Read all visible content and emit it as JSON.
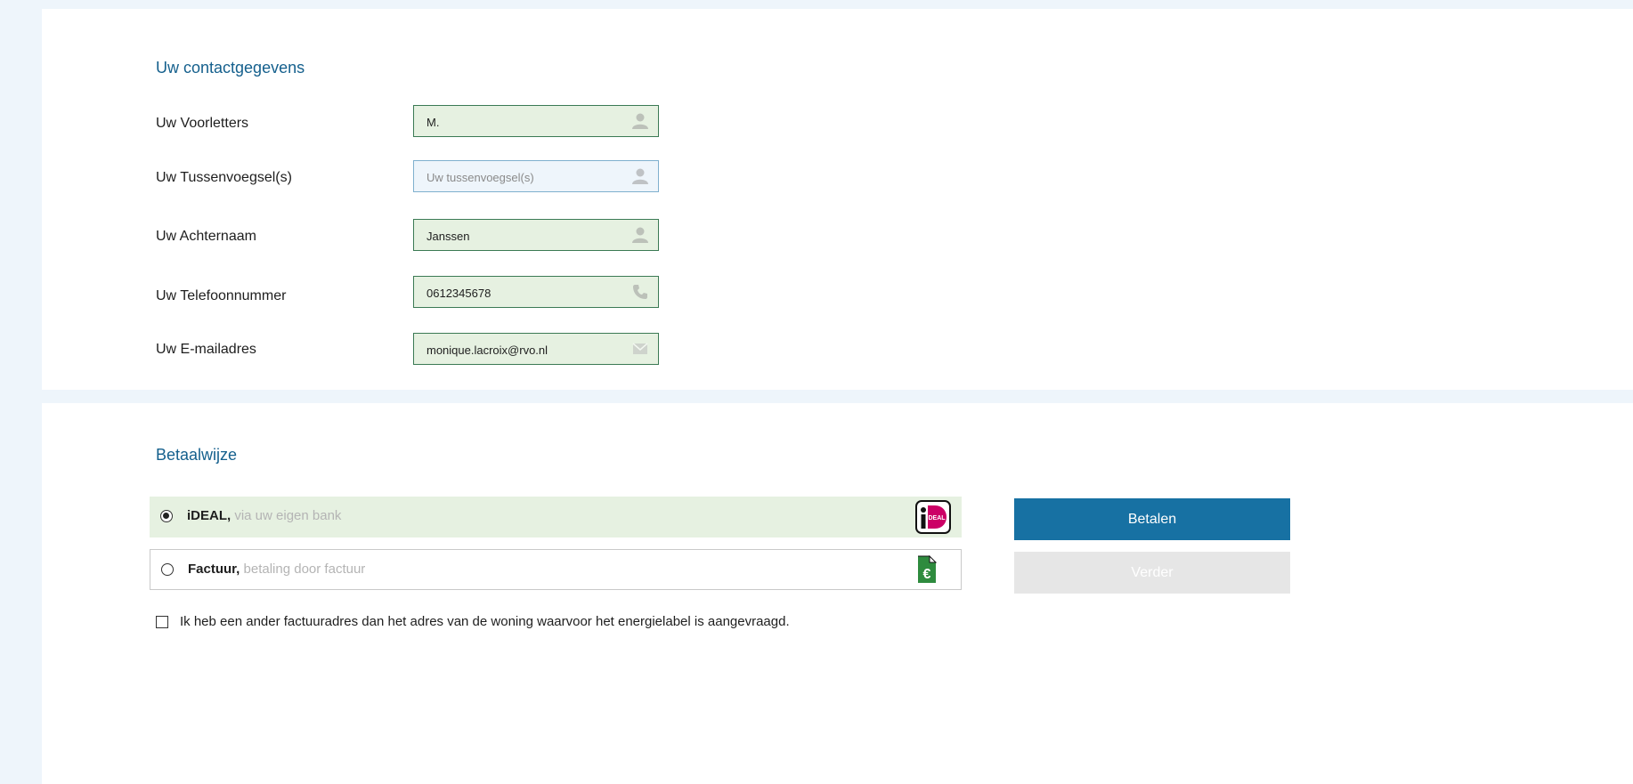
{
  "contact": {
    "title": "Uw contactgegevens",
    "fields": [
      {
        "label": "Uw Voorletters",
        "value": "M.",
        "placeholder": "",
        "icon": "person-icon"
      },
      {
        "label": "Uw Tussenvoegsel(s)",
        "value": "",
        "placeholder": "Uw tussenvoegsel(s)",
        "icon": "person-icon"
      },
      {
        "label": "Uw Achternaam",
        "value": "Janssen",
        "placeholder": "",
        "icon": "person-icon"
      },
      {
        "label": "Uw Telefoonnummer",
        "value": "0612345678",
        "placeholder": "",
        "icon": "phone-icon"
      },
      {
        "label": "Uw E-mailadres",
        "value": "monique.lacroix@rvo.nl",
        "placeholder": "",
        "icon": "envelope-icon"
      }
    ]
  },
  "payment": {
    "title": "Betaalwijze",
    "options": [
      {
        "name": "iDEAL,",
        "description": "via uw eigen bank",
        "selected": true,
        "icon": "ideal-logo-icon"
      },
      {
        "name": "Factuur,",
        "description": "betaling door factuur",
        "selected": false,
        "icon": "euro-invoice-icon"
      }
    ],
    "pay_button": "Betalen",
    "next_button": "Verder",
    "invoice_checkbox": {
      "label": "Ik heb een ander factuuradres dan het adres van de woning waarvoor het energielabel is aangevraagd.",
      "checked": false
    }
  },
  "colors": {
    "accent": "#1771a3",
    "title": "#15608d",
    "field_valid_bg": "#e6f1e1",
    "field_valid_border": "#3b7a54",
    "disabled_button": "#e6e6e6"
  }
}
